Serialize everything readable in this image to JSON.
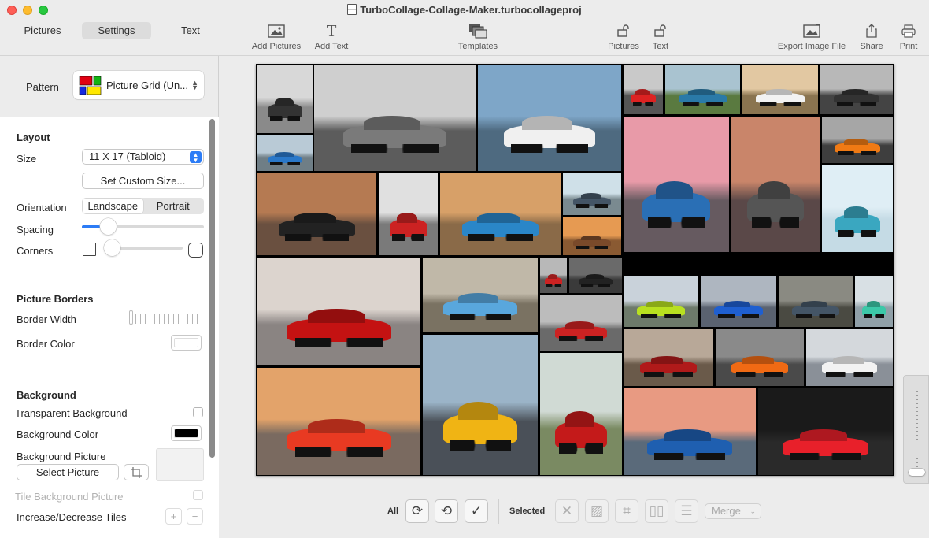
{
  "window": {
    "title": "TurboCollage-Collage-Maker.turbocollageproj"
  },
  "tabs": [
    {
      "label": "Pictures",
      "active": false
    },
    {
      "label": "Settings",
      "active": true
    },
    {
      "label": "Text",
      "active": false
    }
  ],
  "toolbar": {
    "add_pictures": "Add Pictures",
    "add_text": "Add Text",
    "templates": "Templates",
    "lock_pictures": "Pictures",
    "lock_text": "Text",
    "export": "Export Image File",
    "share": "Share",
    "print": "Print"
  },
  "pattern": {
    "label": "Pattern",
    "value": "Picture Grid (Un..."
  },
  "layout": {
    "title": "Layout",
    "size_label": "Size",
    "size_value": "11 X 17 (Tabloid)",
    "custom_size": "Set Custom Size...",
    "orientation_label": "Orientation",
    "orientation_options": [
      "Landscape",
      "Portrait"
    ],
    "orientation_selected": "Landscape",
    "spacing_label": "Spacing",
    "spacing_value": 0.15,
    "corners_label": "Corners",
    "corners_value": 0.0
  },
  "borders": {
    "title": "Picture Borders",
    "width_label": "Border Width",
    "color_label": "Border Color",
    "color": "#ffffff"
  },
  "background": {
    "title": "Background",
    "transparent_label": "Transparent Background",
    "color_label": "Background Color",
    "color": "#000000",
    "picture_label": "Background Picture",
    "select_picture": "Select Picture",
    "tile_label": "Tile Background Picture",
    "tiles_label": "Increase/Decrease Tiles",
    "plus": "+",
    "minus": "−"
  },
  "bottom": {
    "all_label": "All",
    "selected_label": "Selected",
    "merge": "Merge"
  }
}
